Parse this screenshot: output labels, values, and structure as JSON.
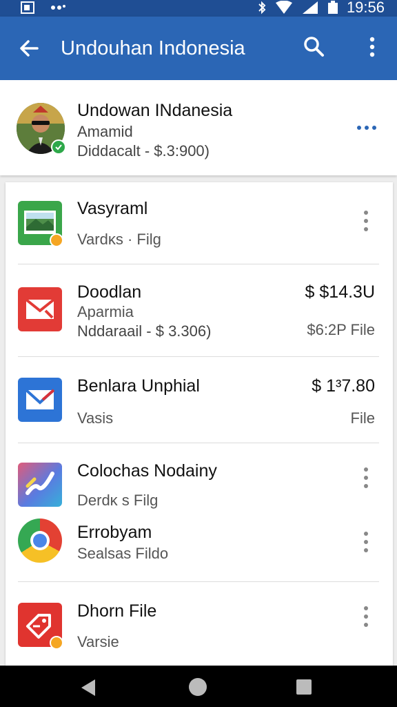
{
  "status_bar": {
    "time": "19:56",
    "icons": [
      "notification-icon",
      "cast-icon",
      "bluetooth-icon",
      "wifi-icon",
      "signal-icon",
      "battery-icon"
    ]
  },
  "app_bar": {
    "title": "Undouhan Indonesia",
    "background": "#2b66b5",
    "icons": [
      "back-arrow-icon",
      "search-icon",
      "more-vert-icon"
    ]
  },
  "profile": {
    "name": "Undowan INdanesia",
    "subtitle": "Amamid",
    "meta": "Diddacalt - $.3:900)",
    "more_icon": "more-horiz-icon",
    "accent": "#2b66b5"
  },
  "items": [
    {
      "title": "Vasyraml",
      "subtitle": "Vardĸs · Filg",
      "subtitle2": "",
      "price": "",
      "size": "",
      "icon": "photo-app-icon",
      "icon_color": "#3aa64a",
      "badge": true,
      "menu": true
    },
    {
      "title": "Doodlan",
      "subtitle": "Aparmia",
      "subtitle2": "Nddaraail - $ 3.306)",
      "price": "$ $14.3U",
      "size": "$6:2P File",
      "icon": "mail-app-icon",
      "icon_color": "#e23b36",
      "badge": false,
      "menu": false
    },
    {
      "title": "Benlara Unphial",
      "subtitle": "Vasis",
      "subtitle2": "",
      "price": "$ 1³7.80",
      "size": "File",
      "icon": "envelope-app-icon",
      "icon_color": "#2d74d6",
      "badge": false,
      "menu": false
    },
    {
      "title": "Colochas Nodainy",
      "subtitle": "Derdĸ s Filg",
      "subtitle2": "",
      "price": "",
      "size": "",
      "icon": "gradient-app-icon",
      "icon_color": "#5a7be0",
      "badge": false,
      "menu": true
    },
    {
      "title": "Errobyam",
      "subtitle": "Sealsas Fildo",
      "subtitle2": "",
      "price": "",
      "size": "",
      "icon": "chrome-app-icon",
      "icon_color": "#35a853",
      "badge": false,
      "menu": true
    },
    {
      "title": "Dhorn File",
      "subtitle": "Varsie",
      "subtitle2": "",
      "price": "",
      "size": "",
      "icon": "tag-app-icon",
      "icon_color": "#e0342f",
      "badge": true,
      "menu": true
    }
  ],
  "nav": {
    "icons": [
      "nav-back-icon",
      "nav-home-icon",
      "nav-recents-icon"
    ]
  }
}
